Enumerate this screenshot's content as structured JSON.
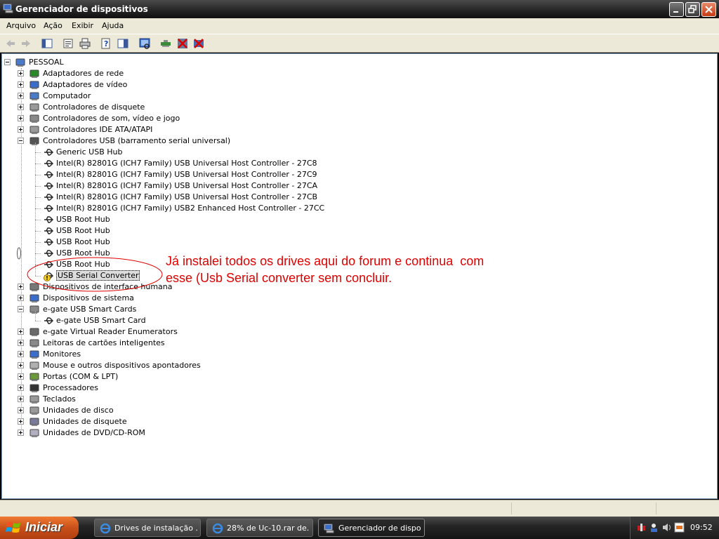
{
  "window": {
    "title": "Gerenciador de dispositivos"
  },
  "menu": [
    {
      "label": "Arquivo"
    },
    {
      "label": "Ação"
    },
    {
      "label": "Exibir"
    },
    {
      "label": "Ajuda"
    }
  ],
  "toolbar": {
    "icons": [
      "back-icon",
      "forward-icon",
      "console-tree-icon",
      "properties-icon",
      "print-icon",
      "help-icon",
      "action-pane-icon",
      "scan-hardware-icon",
      "update-driver-icon",
      "disable-device-icon",
      "uninstall-device-icon"
    ]
  },
  "tree": {
    "root": "PESSOAL",
    "nodes": [
      {
        "label": "Adaptadores de rede",
        "expanded": false,
        "icon": "network-adapter-icon"
      },
      {
        "label": "Adaptadores de vídeo",
        "expanded": false,
        "icon": "display-adapter-icon"
      },
      {
        "label": "Computador",
        "expanded": false,
        "icon": "computer-icon"
      },
      {
        "label": "Controladores de disquete",
        "expanded": false,
        "icon": "floppy-controller-icon"
      },
      {
        "label": "Controladores de som, vídeo e jogo",
        "expanded": false,
        "icon": "sound-icon"
      },
      {
        "label": "Controladores IDE ATA/ATAPI",
        "expanded": false,
        "icon": "ide-controller-icon"
      },
      {
        "label": "Controladores USB (barramento serial universal)",
        "expanded": true,
        "icon": "usb-icon",
        "children": [
          {
            "label": "Generic USB Hub"
          },
          {
            "label": "Intel(R) 82801G (ICH7 Family) USB Universal Host Controller - 27C8"
          },
          {
            "label": "Intel(R) 82801G (ICH7 Family) USB Universal Host Controller - 27C9"
          },
          {
            "label": "Intel(R) 82801G (ICH7 Family) USB Universal Host Controller - 27CA"
          },
          {
            "label": "Intel(R) 82801G (ICH7 Family) USB Universal Host Controller - 27CB"
          },
          {
            "label": "Intel(R) 82801G (ICH7 Family) USB2 Enhanced Host Controller - 27CC"
          },
          {
            "label": "USB Root Hub"
          },
          {
            "label": "USB Root Hub"
          },
          {
            "label": "USB Root Hub"
          },
          {
            "label": "USB Root Hub"
          },
          {
            "label": "USB Root Hub"
          },
          {
            "label": "USB Serial Converter",
            "warning": true,
            "selected": true
          }
        ]
      },
      {
        "label": "Dispositivos de interface humana",
        "expanded": false,
        "icon": "hid-icon"
      },
      {
        "label": "Dispositivos de sistema",
        "expanded": false,
        "icon": "system-device-icon"
      },
      {
        "label": "e-gate USB Smart Cards",
        "expanded": true,
        "icon": "smartcard-icon",
        "children": [
          {
            "label": "e-gate USB Smart Card"
          }
        ]
      },
      {
        "label": "e-gate Virtual Reader Enumerators",
        "expanded": false,
        "icon": "reader-icon"
      },
      {
        "label": "Leitoras de cartões inteligentes",
        "expanded": false,
        "icon": "smartcard-reader-icon"
      },
      {
        "label": "Monitores",
        "expanded": false,
        "icon": "monitor-icon"
      },
      {
        "label": "Mouse e outros dispositivos apontadores",
        "expanded": false,
        "icon": "mouse-icon"
      },
      {
        "label": "Portas (COM & LPT)",
        "expanded": false,
        "icon": "port-icon"
      },
      {
        "label": "Processadores",
        "expanded": false,
        "icon": "processor-icon"
      },
      {
        "label": "Teclados",
        "expanded": false,
        "icon": "keyboard-icon"
      },
      {
        "label": "Unidades de disco",
        "expanded": false,
        "icon": "disk-drive-icon"
      },
      {
        "label": "Unidades de disquete",
        "expanded": false,
        "icon": "floppy-drive-icon"
      },
      {
        "label": "Unidades de DVD/CD-ROM",
        "expanded": false,
        "icon": "dvd-drive-icon"
      }
    ]
  },
  "annotation": {
    "text": "Já instalei todos os drives aqui do forum e continua  com\nesse (Usb Serial converter sem concluir.",
    "color": "#e00000"
  },
  "taskbar": {
    "start_label": "Iniciar",
    "tasks": [
      {
        "label": "Drives de instalação ...",
        "active": false
      },
      {
        "label": "28% de Uc-10.rar de...",
        "active": false
      },
      {
        "label": "Gerenciador de dispo...",
        "active": true
      }
    ],
    "clock": "09:52"
  }
}
